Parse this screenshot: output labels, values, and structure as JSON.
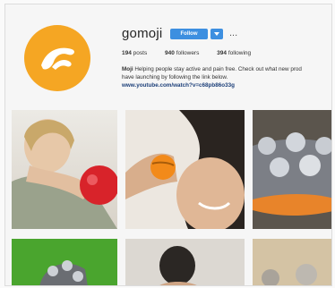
{
  "profile": {
    "username": "gomoji",
    "follow_label": "Follow",
    "more_label": "...",
    "posts_count": "194",
    "posts_label": "posts",
    "followers_count": "940",
    "followers_label": "followers",
    "following_count": "394",
    "following_label": "following",
    "bio_name": "Moji",
    "bio_line1": " Helping people stay active and pain free. Check out what new prod",
    "bio_line2": "have launching by following the link below.",
    "bio_link": "www.youtube.com/watch?v=c68pb86o33g"
  },
  "colors": {
    "avatar_orange": "#f5a623",
    "follow_blue": "#3d8fe0",
    "link_blue": "#1c3f79"
  }
}
